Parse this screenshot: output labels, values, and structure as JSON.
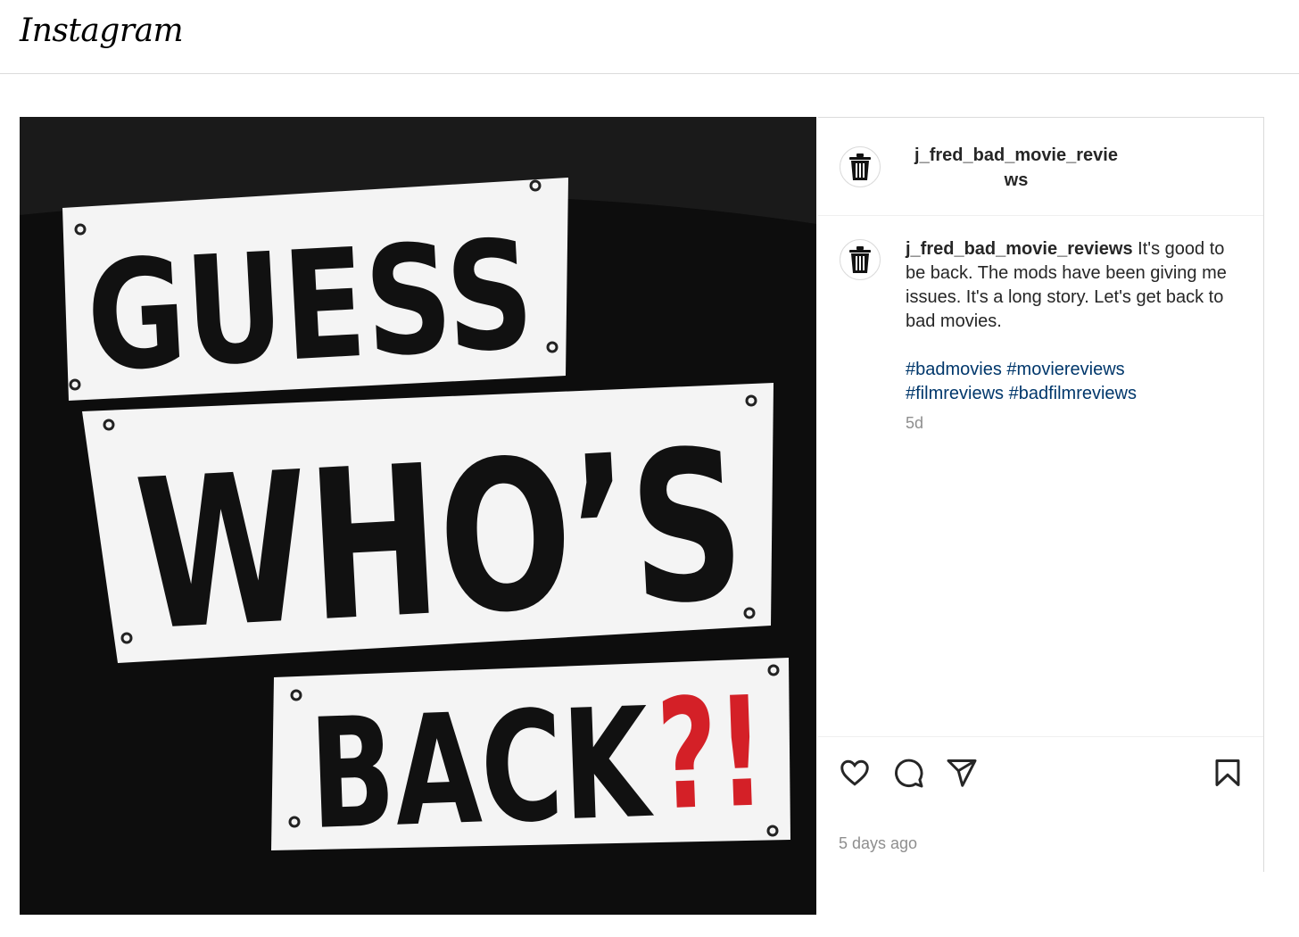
{
  "app": {
    "logo": "Instagram"
  },
  "post": {
    "image": {
      "lines": [
        "GUESS",
        "WHO’S",
        "BACK"
      ],
      "punctuation": "?!",
      "text_color": "#111111",
      "accent_color": "#d42027"
    },
    "header": {
      "username_line1": "j_fred_bad_movie_revie",
      "username_line2": "ws",
      "avatar_icon": "trash-can-icon"
    },
    "caption": {
      "username": "j_fred_bad_movie_reviews",
      "text": " It's good to be back. The mods have been giving me issues. It's a long story. Let's get back to bad movies.",
      "hashtags": [
        "#badmovies",
        "#moviereviews",
        "#filmreviews",
        "#badfilmreviews"
      ],
      "age": "5d"
    },
    "actions": {
      "like_icon": "heart-icon",
      "comment_icon": "comment-icon",
      "share_icon": "share-icon",
      "save_icon": "bookmark-icon"
    },
    "timestamp": "5 days ago"
  }
}
